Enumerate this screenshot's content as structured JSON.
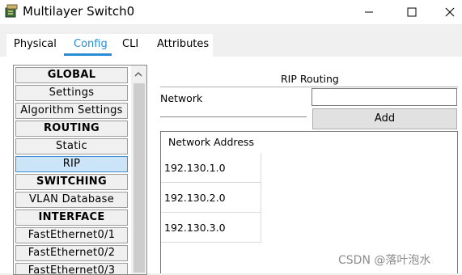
{
  "window": {
    "title": "Multilayer Switch0"
  },
  "tabs": [
    {
      "label": "Physical"
    },
    {
      "label": "Config"
    },
    {
      "label": "CLI"
    },
    {
      "label": "Attributes"
    }
  ],
  "sidebar": {
    "items": [
      {
        "label": "GLOBAL",
        "type": "header"
      },
      {
        "label": "Settings",
        "type": "item"
      },
      {
        "label": "Algorithm Settings",
        "type": "item"
      },
      {
        "label": "ROUTING",
        "type": "header"
      },
      {
        "label": "Static",
        "type": "item"
      },
      {
        "label": "RIP",
        "type": "item",
        "selected": true
      },
      {
        "label": "SWITCHING",
        "type": "header"
      },
      {
        "label": "VLAN Database",
        "type": "item"
      },
      {
        "label": "INTERFACE",
        "type": "header"
      },
      {
        "label": "FastEthernet0/1",
        "type": "item"
      },
      {
        "label": "FastEthernet0/2",
        "type": "item"
      },
      {
        "label": "FastEthernet0/3",
        "type": "item"
      }
    ]
  },
  "rip": {
    "title": "RIP Routing",
    "network_label": "Network",
    "network_value": "",
    "add_label": "Add",
    "table": {
      "header": "Network Address",
      "rows": [
        "192.130.1.0",
        "192.130.2.0",
        "192.130.3.0"
      ]
    }
  },
  "watermark": "CSDN @落叶泡水",
  "colors": {
    "accent": "#2b8cd6",
    "selected_bg": "#cce4f7"
  }
}
